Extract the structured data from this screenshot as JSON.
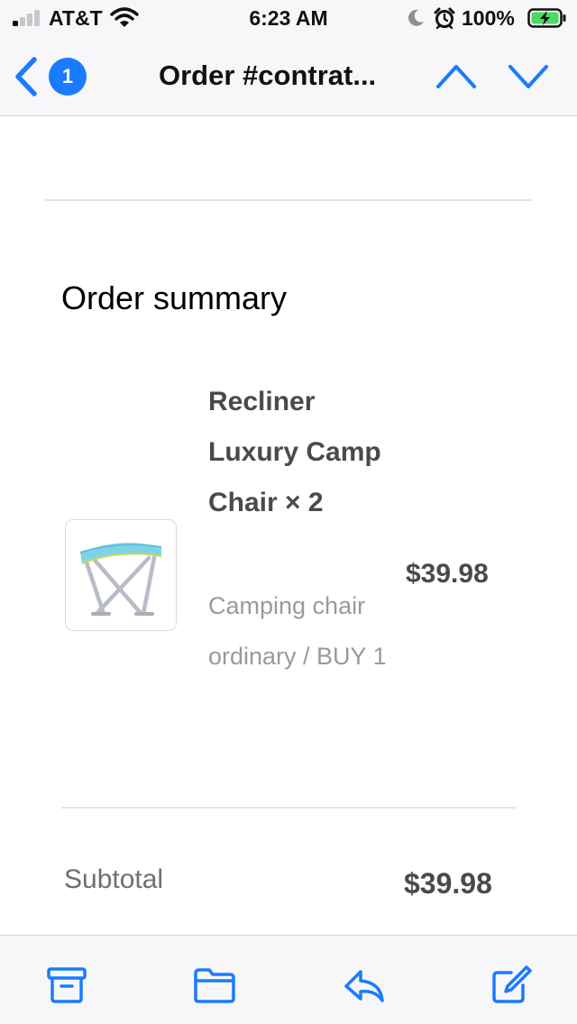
{
  "status_bar": {
    "carrier": "AT&T",
    "time": "6:23 AM",
    "battery_percent": "100%",
    "signal_bars_active": 1,
    "icons": [
      "signal-icon",
      "wifi-icon",
      "moon-icon",
      "alarm-icon",
      "battery-charging-icon"
    ]
  },
  "nav": {
    "unread_count": "1",
    "title": "Order #contrat...",
    "icons": [
      "back-chevron-icon",
      "previous-message-icon",
      "next-message-icon"
    ],
    "accent_color": "#1a7bff"
  },
  "email": {
    "summary_heading": "Order summary",
    "product": {
      "name": "Recliner Luxury Camp Chair × 2",
      "variant": "Camping chair ordinary / BUY 1",
      "price": "$39.98",
      "image_icon": "camp-stool-icon"
    },
    "subtotal": {
      "label": "Subtotal",
      "value": "$39.98"
    }
  },
  "toolbar": {
    "icons": [
      "archive-icon",
      "folder-icon",
      "reply-icon",
      "compose-icon"
    ],
    "color": "#1a7bff"
  }
}
